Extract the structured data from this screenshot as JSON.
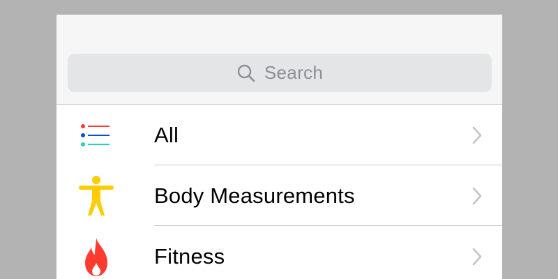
{
  "search": {
    "placeholder": "Search",
    "icon": "magnifying-glass"
  },
  "categories": [
    {
      "label": "All",
      "icon": "list-icon",
      "colors": [
        "#ff3b30",
        "#0050d8",
        "#1ad3c0"
      ]
    },
    {
      "label": "Body Measurements",
      "icon": "body-figure-icon",
      "color": "#ffcc00"
    },
    {
      "label": "Fitness",
      "icon": "flame-icon",
      "color": "#ff3b30"
    }
  ],
  "colors": {
    "header_bg": "#f6f6f6",
    "search_bg": "#e4e5e7",
    "placeholder": "#8e8e93",
    "chevron": "#c4c4c7",
    "separator": "#c8c7cc"
  }
}
